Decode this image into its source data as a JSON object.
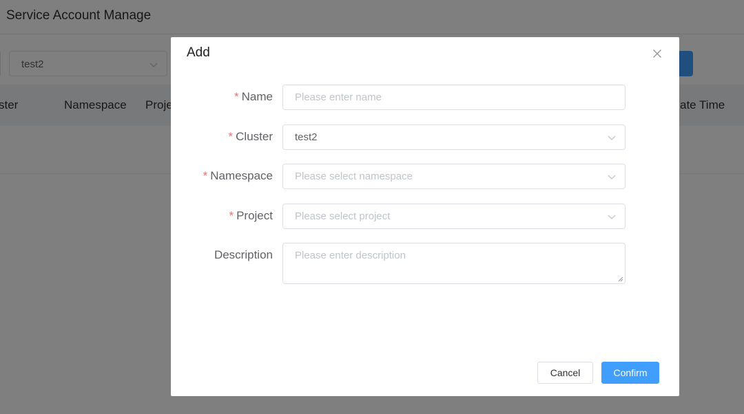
{
  "page": {
    "title": "Service Account Manage",
    "filter": {
      "cluster_value": "test2"
    },
    "table": {
      "headers": {
        "cluster": "ster",
        "namespace": "Namespace",
        "project": "Proje",
        "create_time": "ate Time"
      }
    }
  },
  "dialog": {
    "title": "Add",
    "fields": {
      "name": {
        "label": "Name",
        "required_mark": "*",
        "value": "",
        "placeholder": "Please enter name"
      },
      "cluster": {
        "label": "Cluster",
        "required_mark": "*",
        "value": "test2"
      },
      "namespace": {
        "label": "Namespace",
        "required_mark": "*",
        "placeholder": "Please select namespace"
      },
      "project": {
        "label": "Project",
        "required_mark": "*",
        "placeholder": "Please select project"
      },
      "description": {
        "label": "Description",
        "value": "",
        "placeholder": "Please enter description"
      }
    },
    "buttons": {
      "cancel": "Cancel",
      "confirm": "Confirm"
    }
  },
  "colors": {
    "primary": "#409eff",
    "required": "#f56c6c",
    "overlay": "rgba(0,0,0,0.5)"
  },
  "icons": {
    "close": "close-icon",
    "dropdown": "chevron-down-icon"
  }
}
